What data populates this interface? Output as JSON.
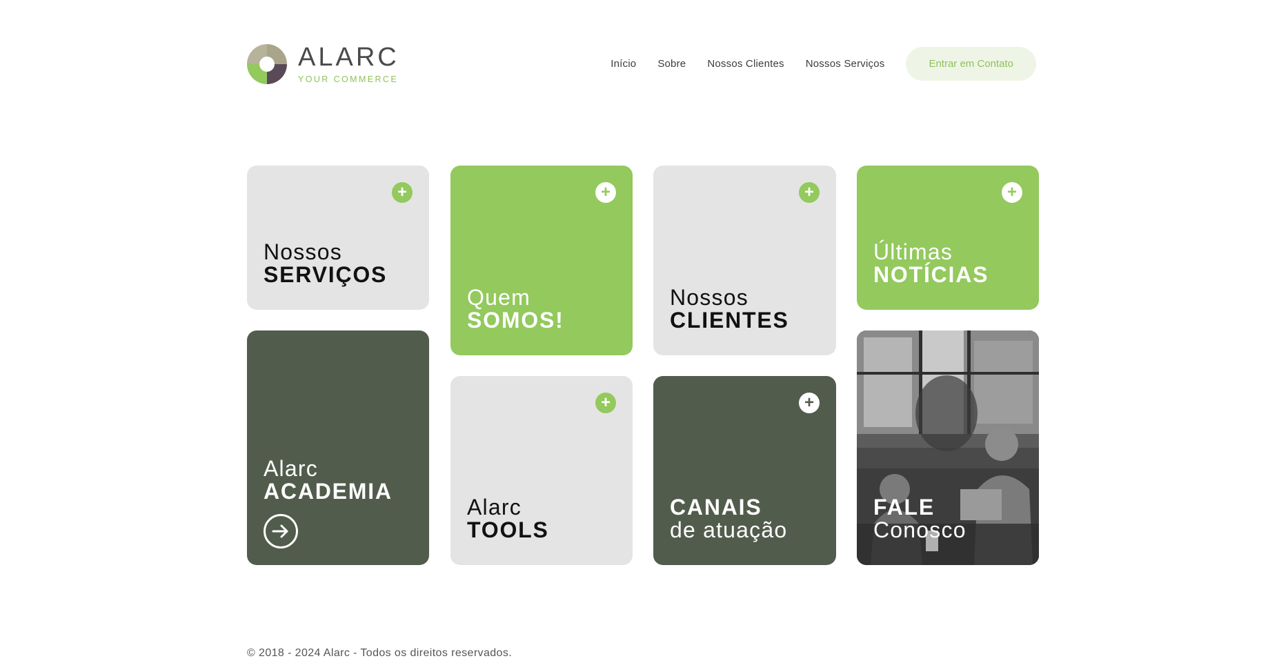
{
  "header": {
    "logo": {
      "name": "ALARC",
      "tagline": "YOUR COMMERCE"
    },
    "nav": [
      {
        "label": "Início"
      },
      {
        "label": "Sobre"
      },
      {
        "label": "Nossos Clientes"
      },
      {
        "label": "Nossos Serviços"
      }
    ],
    "cta_label": "Entrar em Contato"
  },
  "cards": {
    "servicos": {
      "line1": "Nossos",
      "line2": "SERVIÇOS",
      "icon": "plus-icon"
    },
    "quem_somos": {
      "line1": "Quem",
      "line2": "SOMOS!",
      "icon": "plus-icon"
    },
    "clientes": {
      "line1": "Nossos",
      "line2": "CLIENTES",
      "icon": "plus-icon"
    },
    "noticias": {
      "line1": "Últimas",
      "line2": "NOTÍCIAS",
      "icon": "plus-icon"
    },
    "academia": {
      "line1": "Alarc",
      "line2": "ACADEMIA",
      "icon": "arrow-right-circle-icon"
    },
    "tools": {
      "line1": "Alarc",
      "line2": "TOOLS",
      "icon": "plus-icon"
    },
    "canais": {
      "line1": "CANAIS",
      "line2": "de atuação",
      "icon": "plus-icon"
    },
    "fale": {
      "line1": "FALE",
      "line2": "Conosco"
    }
  },
  "footer": {
    "copyright": "© 2018 - 2024 Alarc - Todos os direitos reservados."
  },
  "colors": {
    "green": "#93c95d",
    "dark_green": "#525c4c",
    "light_gray": "#e4e4e4",
    "cta_bg": "#eef5e6",
    "logo_olive": "#a9a58a",
    "logo_purple": "#5a4a58"
  }
}
